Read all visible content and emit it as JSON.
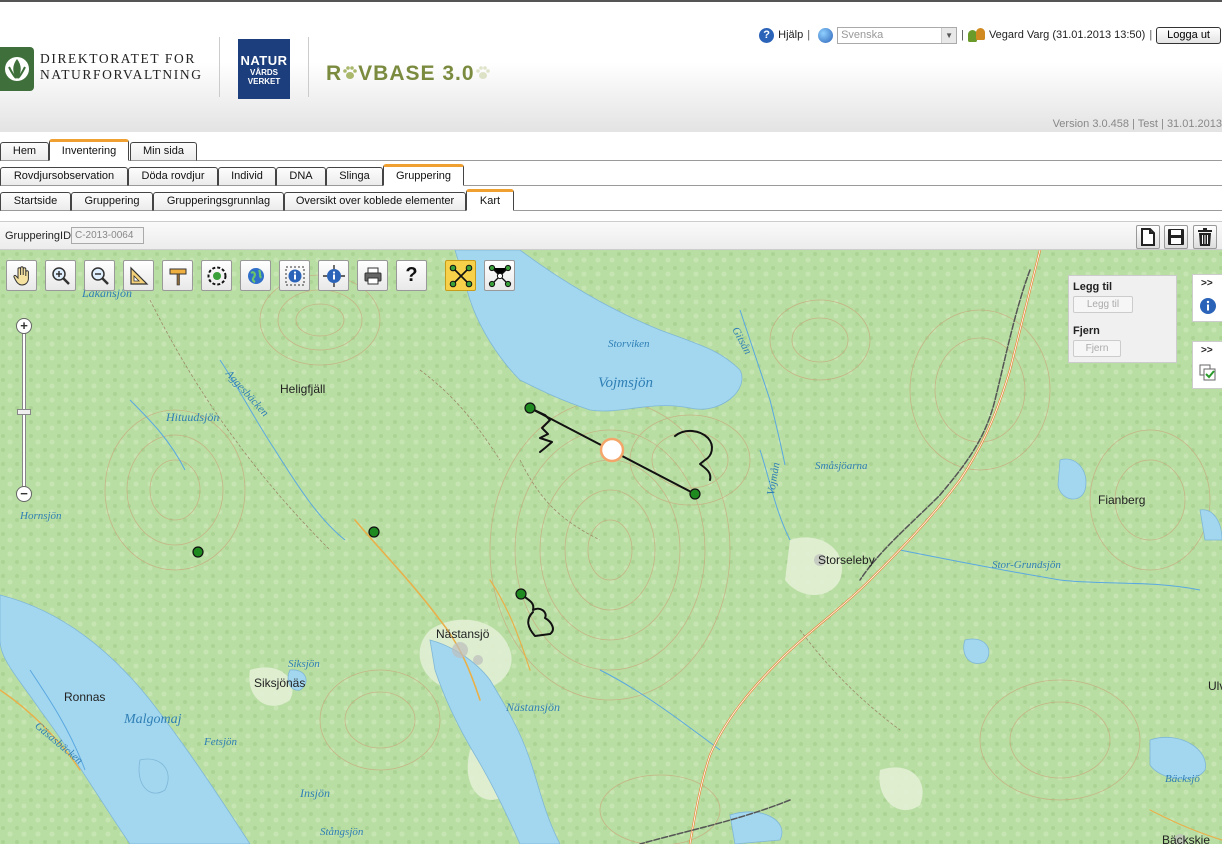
{
  "header": {
    "org_line1": "DIREKTORATET FOR",
    "org_line2": "NATURFORVALTNING",
    "nv_line1": "NATUR",
    "nv_line2": "VÅRDS",
    "nv_line3": "VERKET",
    "app_name_prefix": "R",
    "app_name_suffix": "VBASE 3.0",
    "help_label": "Hjälp",
    "language_selected": "Svenska",
    "user_info": "Vegard Varg (31.01.2013 13:50)",
    "logout_label": "Logga ut",
    "version": "Version 3.0.458 | Test | 31.01.2013"
  },
  "tabs_main": [
    "Hem",
    "Inventering",
    "Min sida"
  ],
  "tabs_inventering": [
    "Rovdjursobservation",
    "Döda rovdjur",
    "Individ",
    "DNA",
    "Slinga",
    "Gruppering"
  ],
  "tabs_gruppering": [
    "Startside",
    "Gruppering",
    "Grupperingsgrunnlag",
    "Oversikt over koblede elementer",
    "Kart"
  ],
  "id_bar": {
    "label": "GrupperingID",
    "value": "C-2013-0064"
  },
  "map_tools": [
    "pan-icon",
    "zoom-in-icon",
    "zoom-out-icon",
    "measure-icon",
    "signpost-icon",
    "select-circle-icon",
    "globe-icon",
    "info-icon",
    "info-select-icon",
    "print-icon",
    "help-icon",
    "network-active-icon",
    "network-icon"
  ],
  "side_panel": {
    "add_heading": "Legg til",
    "add_button": "Legg til",
    "remove_heading": "Fjern",
    "remove_button": "Fjern"
  },
  "map_labels": {
    "places": [
      "Heligfjäll",
      "Storseleby",
      "Fianberg",
      "Nästansjö",
      "Siksjönäs",
      "Ronnas",
      "Bäckskje",
      "Ulv"
    ],
    "waters": [
      "Lakansjön",
      "Storviken",
      "Vojmsjön",
      "Gitsån",
      "Hituudsjön",
      "Aggesbäcken",
      "Småsjöarna",
      "Vojmån",
      "Hornsjön",
      "Stor-Grundsjön",
      "Siksjön",
      "Malgomaj",
      "Gäsasbäcken",
      "Fetsjön",
      "Insjön",
      "Nästansjön",
      "Stångsjön",
      "Bäcksjö"
    ]
  },
  "colors": {
    "active_tab_accent": "#f0a030",
    "map_land": "#b8dca3",
    "map_water": "#a3d7f0",
    "track": "#111111",
    "point": "#1f8a1f",
    "selected_marker": "#f4a66a"
  }
}
